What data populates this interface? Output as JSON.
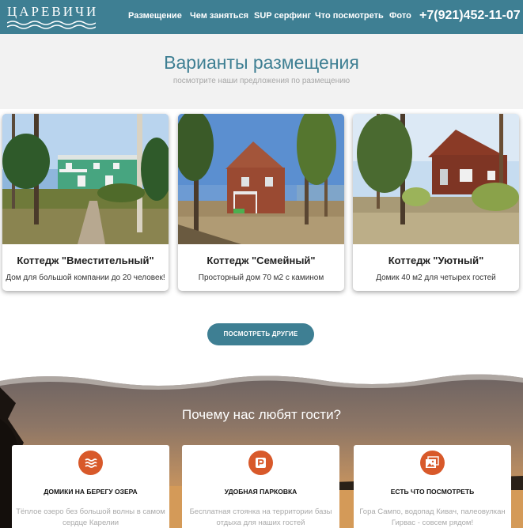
{
  "header": {
    "logo_text": "ЦАРЕВИЧИ",
    "nav": [
      "Размещение",
      "Чем заняться",
      "SUP серфинг",
      "Что посмотреть",
      "Фото"
    ],
    "phone": "+7(921)452-11-07"
  },
  "accommodation": {
    "title": "Варианты размещения",
    "subtitle": "посмотрите наши предложения по размещению",
    "cards": [
      {
        "title": "Коттедж \"Вместительный\"",
        "desc": "Дом для большой компании до 20 человек!"
      },
      {
        "title": "Коттедж \"Семейный\"",
        "desc": "Просторный дом 70 м2 с камином"
      },
      {
        "title": "Коттедж \"Уютный\"",
        "desc": "Домик 40 м2 для четырех гостей"
      }
    ],
    "more_button": "ПОСМОТРЕТЬ ДРУГИЕ"
  },
  "why": {
    "title": "Почему нас любят гости?",
    "features": [
      {
        "icon": "waves-icon",
        "title": "ДОМИКИ НА БЕРЕГУ ОЗЕРА",
        "text": "Тёплое озеро без большой волны в самом сердце Карелии"
      },
      {
        "icon": "parking-icon",
        "title": "УДОБНАЯ ПАРКОВКА",
        "text": "Бесплатная стоянка на территории базы отдыха для наших гостей"
      },
      {
        "icon": "photos-icon",
        "title": "ЕСТЬ ЧТО ПОСМОТРЕТЬ",
        "text": "Гора Сампо, водопад Кивач, палеовулкан Гирвас - совсем рядом!"
      }
    ]
  },
  "colors": {
    "primary": "#3e7f93",
    "accent": "#d8592a"
  }
}
